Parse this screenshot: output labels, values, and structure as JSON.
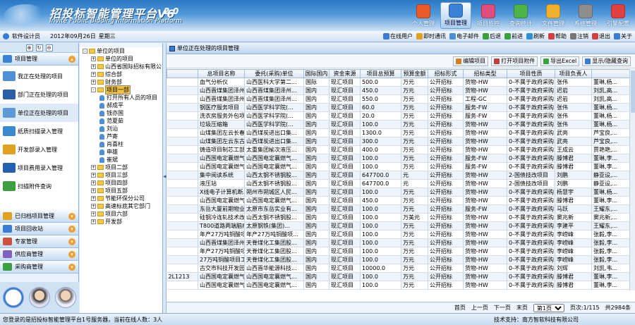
{
  "header": {
    "title": "招投标智能管理平台V6",
    "version": "2.0",
    "subtitle": "Invite Public Bidding Information Platform",
    "nav": [
      {
        "label": "个人管理",
        "icon": "person-icon",
        "color": "#e85b2a"
      },
      {
        "label": "项目管理",
        "icon": "project-icon",
        "color": "#3a82d6",
        "active": true
      },
      {
        "label": "项目监控",
        "icon": "monitor-icon",
        "color": "#e04d7a"
      },
      {
        "label": "查询统计",
        "icon": "chart-icon",
        "color": "#4db34a"
      },
      {
        "label": "文件管理",
        "icon": "folder-icon",
        "color": "#f0b030"
      },
      {
        "label": "系统管理",
        "icon": "tools-icon",
        "color": "#8e8e8e"
      },
      {
        "label": "引擎配置",
        "icon": "engine-icon",
        "color": "#e04040"
      }
    ]
  },
  "infobar": {
    "user": "软件设计员",
    "date": "2012年09月26日",
    "weekday": "星期三",
    "quick": [
      {
        "label": "在线用户",
        "icon": "users-icon",
        "color": "#3a7bd5"
      },
      {
        "label": "即时通讯",
        "icon": "chat-icon",
        "color": "#e0a020"
      },
      {
        "label": "电子邮件",
        "icon": "mail-icon",
        "color": "#4a8ed8"
      },
      {
        "label": "后退",
        "icon": "back-icon",
        "color": "#3aa040"
      },
      {
        "label": "前进",
        "icon": "forward-icon",
        "color": "#3aa040"
      },
      {
        "label": "刷新",
        "icon": "refresh-icon",
        "color": "#2d8fd5"
      },
      {
        "label": "帮助",
        "icon": "help-icon",
        "color": "#d04040"
      },
      {
        "label": "注销",
        "icon": "logout-icon",
        "color": "#777777"
      },
      {
        "label": "退出",
        "icon": "exit-icon",
        "color": "#d04040"
      },
      {
        "label": "关于",
        "icon": "about-icon",
        "color": "#3a7bd5"
      }
    ]
  },
  "left": {
    "top_menu": {
      "label": "项目管理"
    },
    "sub_items": [
      {
        "label": "我正在处理的项目",
        "color": "#4f8fd8"
      },
      {
        "label": "部门正在处理的项目",
        "color": "#2a5fa8"
      },
      {
        "label": "单位正在处理的项目",
        "color": "#5a9ad8",
        "selected": true
      },
      {
        "label": "纸质扫描录入管理",
        "color": "#3a8ad0"
      },
      {
        "label": "开发部录入管理",
        "color": "#e0a020"
      },
      {
        "label": "项目费用录入管理",
        "color": "#2560b0"
      },
      {
        "label": "扫描附件查询",
        "color": "#3aa040"
      }
    ],
    "bottom_menus": [
      {
        "label": "已归档项目管理",
        "color": "#e0a020"
      },
      {
        "label": "项目回收站",
        "color": "#3a7bd5"
      },
      {
        "label": "专家管理",
        "color": "#d05040"
      },
      {
        "label": "供应商管理",
        "color": "#8060c0"
      },
      {
        "label": "采购商管理",
        "color": "#3aa040"
      }
    ]
  },
  "tree": {
    "nodes": [
      {
        "label": "单位的项目",
        "level": 0,
        "type": "folder",
        "box": "-"
      },
      {
        "label": "单位的项目",
        "level": 1,
        "type": "folder",
        "box": "+"
      },
      {
        "label": "山西省国际招标有限公",
        "level": 1,
        "type": "folder",
        "box": "+"
      },
      {
        "label": "综合部",
        "level": 1,
        "type": "folder",
        "box": "+"
      },
      {
        "label": "财务部",
        "level": 1,
        "type": "folder",
        "box": "+"
      },
      {
        "label": "项目一部",
        "level": 1,
        "type": "folder",
        "box": "-",
        "highlight": true
      },
      {
        "label": "打开所有人员的项目",
        "level": 2,
        "type": "person"
      },
      {
        "label": "郝成平",
        "level": 2,
        "type": "person"
      },
      {
        "label": "钱亦国",
        "level": 2,
        "type": "person"
      },
      {
        "label": "范夏茹",
        "level": 2,
        "type": "person"
      },
      {
        "label": "刘汕",
        "level": 2,
        "type": "person"
      },
      {
        "label": "芦寄",
        "level": 2,
        "type": "person"
      },
      {
        "label": "肖喜柱",
        "level": 2,
        "type": "person"
      },
      {
        "label": "申雄",
        "level": 2,
        "type": "person"
      },
      {
        "label": "崔斌",
        "level": 2,
        "type": "person"
      },
      {
        "label": "项目二部",
        "level": 1,
        "type": "folder",
        "box": "+"
      },
      {
        "label": "项目三部",
        "level": 1,
        "type": "folder",
        "box": "+"
      },
      {
        "label": "项目四部",
        "level": 1,
        "type": "folder",
        "box": "+"
      },
      {
        "label": "项目五部",
        "level": 1,
        "type": "folder",
        "box": "+"
      },
      {
        "label": "节能环保分公司",
        "level": 1,
        "type": "folder",
        "box": "+"
      },
      {
        "label": "高速标底其它部门",
        "level": 1,
        "type": "folder",
        "box": "+"
      },
      {
        "label": "项目六部",
        "level": 1,
        "type": "folder",
        "box": "+"
      },
      {
        "label": "开发部",
        "level": 1,
        "type": "folder",
        "box": "+"
      }
    ]
  },
  "main": {
    "title": "单位正在处理的项目管理",
    "actions": [
      {
        "label": "编辑项目",
        "color": "#d08020"
      },
      {
        "label": "打开项目附件",
        "color": "#c04040"
      },
      {
        "label": "导出Excel",
        "color": "#3aa040"
      },
      {
        "label": "显示/隐藏查询",
        "color": "#3a7bd5"
      }
    ],
    "columns": [
      "总项目名称",
      "委托(采购)单位",
      "国际国内",
      "资金来源",
      "项目总预算",
      "预算金额",
      "招标形式",
      "招标类型",
      "项目性质",
      "项目负责人",
      ""
    ],
    "rows": [
      [
        "",
        "血气分析仪",
        "山西医科大学第二...",
        "国际",
        "现汇项目",
        "500.0",
        "万元",
        "公开招标",
        "货物-HW",
        "0-不属于政府采购...",
        "张伟",
        "董琳,杨..."
      ],
      [
        "",
        "山西晋煤集团泽州...",
        "山西晋煤集团泽州...",
        "国内",
        "现汇项目",
        "450.0",
        "万元",
        "公开招标",
        "货物-HW",
        "0-不属于政府采购...",
        "迟岩",
        "刘凯,高..."
      ],
      [
        "",
        "山西晋煤集团泽州...",
        "山西晋煤集团泽州...",
        "国内",
        "现汇项目",
        "550.0",
        "万元",
        "公开招标",
        "工程-GC",
        "0-不属于政府采购...",
        "迟岩",
        "刘凯,高..."
      ],
      [
        "",
        "钢医疗服务项目",
        "山西医学科学院(...",
        "国内",
        "现汇项目",
        "60.0",
        "万元",
        "公开招标",
        "服务-FW",
        "0-不属于政府采购...",
        "张伟",
        "董琳,杨..."
      ],
      [
        "",
        "洗衣房服务外包项目",
        "山西医学科学院(...",
        "国内",
        "现汇项目",
        "20.0",
        "万元",
        "公开招标",
        "服务-FW",
        "0-不属于政府采购...",
        "张伟",
        "董琳,杨..."
      ],
      [
        "",
        "垃圾压缩箱",
        "山西医学科学院(...",
        "国内",
        "现汇项目",
        "100.0",
        "万元",
        "公开招标",
        "货物-HW",
        "0-不属于政府采购...",
        "张伟",
        "董琳,杨..."
      ],
      [
        "",
        "山煤集团左云长春...",
        "山西煤炭进出口集...",
        "国内",
        "现汇项目",
        "1300.0",
        "万元",
        "公开招标",
        "货物-HW",
        "0-不属于政府采购...",
        "武亮",
        "芦宝良,..."
      ],
      [
        "",
        "山煤集团左云东古...",
        "山西煤炭进出口集...",
        "国内",
        "现汇项目",
        "300.0",
        "万元",
        "公开招标",
        "货物-HW",
        "0-不属于政府采购...",
        "武亮",
        "芦宝良,..."
      ],
      [
        "",
        "铸造项目制芯工部...",
        "太重集团榆次液压...",
        "国内",
        "现汇项目",
        "400.0",
        "万元",
        "公开招标",
        "货物-HW",
        "0-不属于政府采购...",
        "王成云",
        "贾艳艳,..."
      ],
      [
        "",
        "山西国电定襄燃气...",
        "山西国电定襄燃气...",
        "国内",
        "现汇项目",
        "100.0",
        "万元",
        "公开招标",
        "服务-FW",
        "0-不属于政府采购...",
        "滕博君",
        "董琳,李..."
      ],
      [
        "",
        "山西国电定襄燃气...",
        "山西国电定襄燃气...",
        "国内",
        "现汇项目",
        "100.0",
        "万元",
        "公开招标",
        "服务-FW",
        "0-不属于政府采购...",
        "滕博君",
        "董琳,李..."
      ],
      [
        "",
        "集中阅读系统",
        "山西太钢不锈钢股...",
        "国内",
        "现汇项目",
        "647700.0",
        "元",
        "公开招标",
        "货物-HW",
        "2-国债技改项目",
        "刘鹏",
        "静亚设,..."
      ],
      [
        "",
        "液压站",
        "山西太钢不锈钢股...",
        "国内",
        "现汇项目",
        "647700.0",
        "元",
        "公开招标",
        "货物-HW",
        "2-国债技改项目",
        "刘鹏",
        "静亚设,..."
      ],
      [
        "",
        "X线电子计算机断...",
        "朔州市朔城区人民...",
        "国内",
        "现汇项目",
        "100.0",
        "万元",
        "公开招标",
        "货物-HW",
        "0-不属于政府采购...",
        "杨慧宇",
        "董琳,杨..."
      ],
      [
        "",
        "山西国电定襄燃气...",
        "山西国电定襄燃气...",
        "国内",
        "现汇项目",
        "450.0",
        "万元",
        "公开招标",
        "货物-HW",
        "0-不属于政府采购...",
        "滕博君",
        "董琳,李..."
      ],
      [
        "",
        "东岳大厦前期物业...",
        "太原市东岳实业有...",
        "国内",
        "现汇项目",
        "100.0",
        "万元",
        "公开招标",
        "服务-FW",
        "0-不属于政府采购...",
        "马跃",
        "王耀东,..."
      ],
      [
        "",
        "硅钢冷连轧技术改...",
        "山西太钢不锈钢股...",
        "国内",
        "现汇项目",
        "100.0",
        "万美元",
        "公开招标",
        "货物-HW",
        "0-不属于政府采购...",
        "窦兆新",
        "窦兆新,..."
      ],
      [
        "",
        "T800道路两端脑瘤...",
        "太原钢铁(集团)...",
        "国内",
        "现汇项目",
        "100.0",
        "万元",
        "公开招标",
        "货物-HW",
        "0-不属于政府采购...",
        "李建平",
        "王耀东,..."
      ],
      [
        "",
        "年产27万吨铜酸项...",
        "年产27万吨铜酸项...",
        "国内",
        "现汇项目",
        "100.0",
        "万元",
        "公开招标",
        "货物-HW",
        "0-不属于政府采购...",
        "李崂峰",
        "张毅,李..."
      ],
      [
        "",
        "山西晋煤集团泽州...",
        "天脊煤化工集团股...",
        "国内",
        "现汇项目",
        "100.0",
        "万元",
        "公开招标",
        "货物-HW",
        "0-不属于政府采购...",
        "李崂峰",
        "张毅,李..."
      ],
      [
        "",
        "年产27万吨铜酸项...",
        "天脊煤化工集团股...",
        "国内",
        "现汇项目",
        "100.0",
        "万元",
        "公开招标",
        "货物-HW",
        "0-不属于政府采购...",
        "李崂峰",
        "张毅,李..."
      ],
      [
        "",
        "27万吨铜酸项目工...",
        "天脊煤化工集团股...",
        "国内",
        "现汇项目",
        "100.0",
        "万元",
        "公开招标",
        "货物-HW",
        "0-不属于政府采购...",
        "李崂峰",
        "张毅,李..."
      ],
      [
        "",
        "古交市科技开发园...",
        "山西晋华能源科技...",
        "国内",
        "现汇项目",
        "10000.0",
        "万元",
        "公开招标",
        "货物-HW",
        "0-不属于政府采购...",
        "刘辉",
        "刘凯,韦..."
      ],
      [
        "2L1213",
        "山西国电定襄燃气...",
        "山西国电定襄燃气...",
        "国内",
        "现汇项目",
        "100.0",
        "万元",
        "公开招标",
        "货物-HW",
        "0-不属于政府采购...",
        "滕博君",
        "董琳,李..."
      ],
      [
        "",
        "山西国电定襄燃气...",
        "山西国电定襄燃气...",
        "国内",
        "现汇项目",
        "100.0",
        "万元",
        "公开招标",
        "货物-HW",
        "0-不属于政府采购...",
        "滕博君",
        "董琳,李..."
      ]
    ],
    "pager": {
      "first": "首页",
      "prev": "上一页",
      "next": "下一页",
      "last": "末页",
      "current": "第1页",
      "page_info": "页次:1/115",
      "total": "共2984条"
    }
  },
  "statusbar": {
    "left": "您登录的是招投标智能管理平台1号服务器，当前在线人数：3人",
    "right": "技术支持：南方智软科技有限公司"
  }
}
